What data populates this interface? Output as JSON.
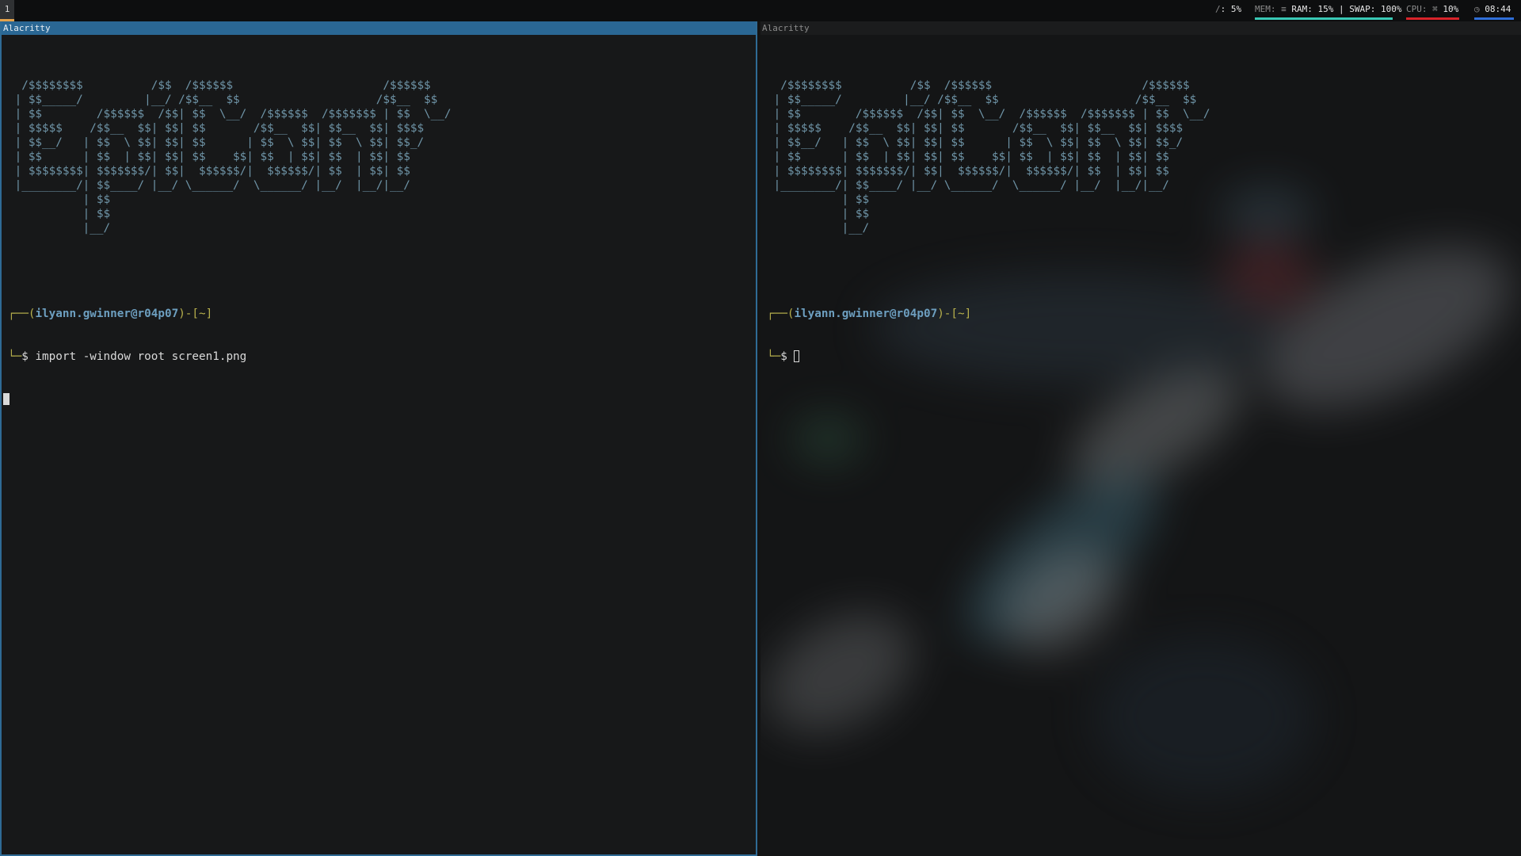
{
  "topbar": {
    "workspace": "1",
    "disk": {
      "icon": "/",
      "value": ": 5%"
    },
    "mem": {
      "label": "MEM:",
      "icon": "≡",
      "value": "RAM: 15% | SWAP: 100%",
      "color": "#39c9b5"
    },
    "cpu": {
      "label": "CPU:",
      "icon": "⌘",
      "value": "10%",
      "color": "#d8232a"
    },
    "clock": {
      "icon": "◷",
      "value": "08:44",
      "color": "#2f6fd8"
    }
  },
  "left_pane": {
    "title": "Alacritty",
    "banner": "  /$$$$$$$$          /$$  /$$$$$$                      /$$$$$$ \n | $$_____/         |__/ /$$__  $$                    /$$__  $$\n | $$        /$$$$$$  /$$| $$  \\__/  /$$$$$$  /$$$$$$$ | $$  \\__/\n | $$$$$    /$$__  $$| $$| $$       /$$__  $$| $$__  $$| $$$$    \n | $$__/   | $$  \\ $$| $$| $$      | $$  \\ $$| $$  \\ $$| $$_/    \n | $$      | $$  | $$| $$| $$    $$| $$  | $$| $$  | $$| $$      \n | $$$$$$$$| $$$$$$$/| $$|  $$$$$$/|  $$$$$$/| $$  | $$| $$      \n |________/| $$____/ |__/ \\______/  \\______/ |__/  |__/|__/      \n           | $$                                                  \n           | $$                                                  \n           |__/                                                  ",
    "prompt_top": "┌──(",
    "user": "ilyann.gwinner@r04p07",
    "mid": ")-[",
    "dir": "~",
    "end": "]",
    "prompt_bottom": "└─",
    "symbol": "$ ",
    "command": "import -window root screen1.png"
  },
  "right_pane": {
    "title": "Alacritty",
    "prompt_top": "┌──(",
    "user": "ilyann.gwinner@r04p07",
    "mid": ")-[",
    "dir": "~",
    "end": "]",
    "prompt_bottom": "└─",
    "symbol": "$ "
  }
}
